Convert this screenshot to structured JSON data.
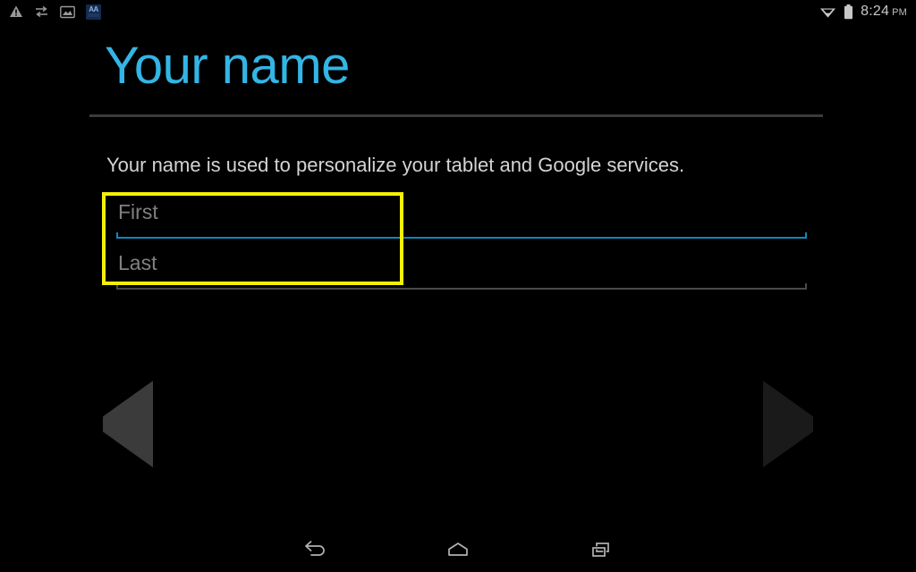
{
  "status_bar": {
    "left_icons": [
      {
        "name": "warning-icon"
      },
      {
        "name": "data-sync-icon"
      },
      {
        "name": "screenshot-icon"
      },
      {
        "name": "app-notification-icon",
        "glyph": "AA"
      }
    ],
    "right_icons": [
      {
        "name": "wifi-icon"
      },
      {
        "name": "battery-icon"
      }
    ],
    "time": "8:24",
    "meridiem": "PM"
  },
  "header": {
    "title": "Your name"
  },
  "main": {
    "description": "Your name is used to personalize your tablet and Google services.",
    "fields": [
      {
        "name": "first-name",
        "placeholder": "First",
        "value": "",
        "focused": true
      },
      {
        "name": "last-name",
        "placeholder": "Last",
        "value": "",
        "focused": false
      }
    ]
  },
  "wizard": {
    "back_label": "Back",
    "next_label": "Next"
  },
  "navigation_bar": {
    "back_label": "Back",
    "home_label": "Home",
    "recents_label": "Recent apps"
  },
  "colors": {
    "accent_blue": "#33b5e5",
    "focused_underline": "#0b89bd",
    "unfocused_underline": "#4a4a4a",
    "highlight_yellow": "#f5f006",
    "background": "#000000",
    "placeholder_grey": "#808080",
    "body_text": "#d4d4d4"
  }
}
